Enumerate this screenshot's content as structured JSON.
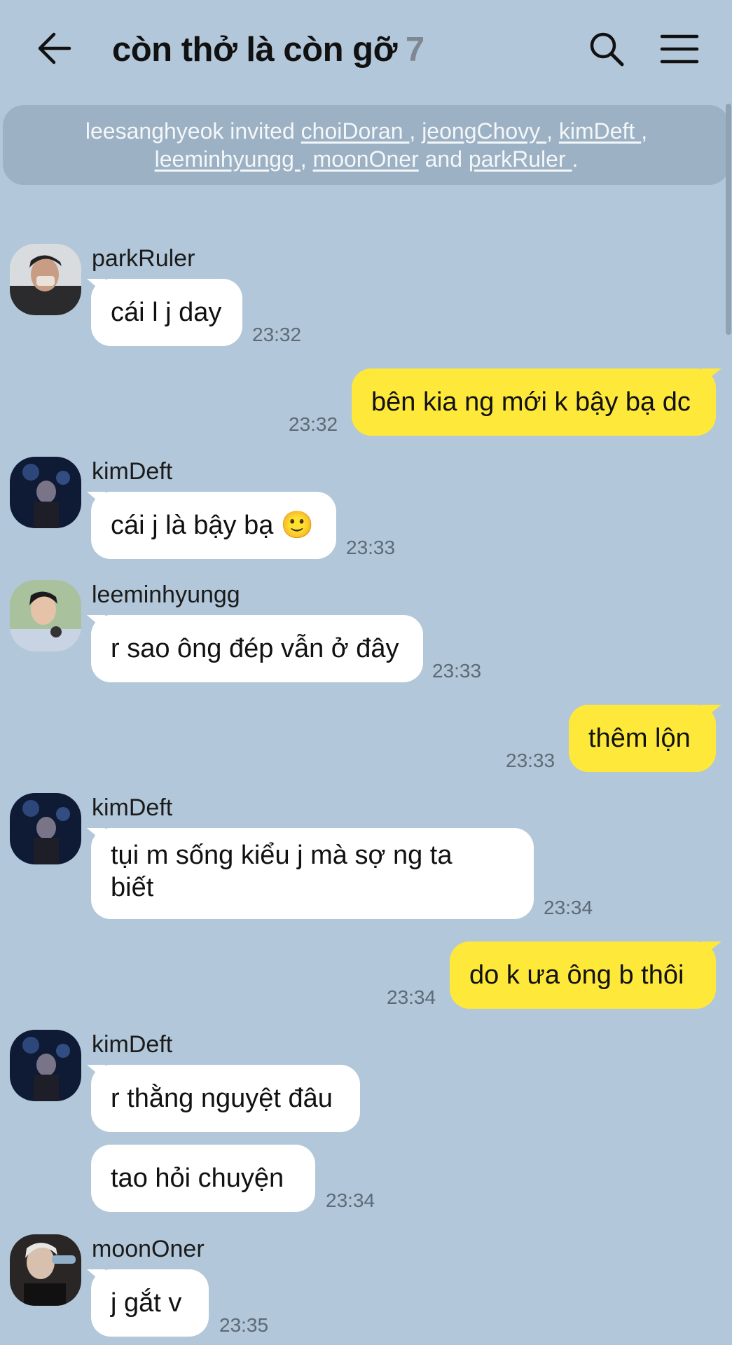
{
  "header": {
    "title": "còn thở là còn gỡ",
    "member_count": "7"
  },
  "notice": {
    "inviter": "leesanghyeok",
    "invited_word": "invited",
    "invitees": [
      "choiDoran ",
      "jeongChovy ",
      "kimDeft ",
      "leeminhyungg ",
      "moonOner",
      "parkRuler "
    ],
    "and_word": "and"
  },
  "messages": [
    {
      "sender": "parkRuler",
      "text": "cái l j day",
      "time": "23:32",
      "mine": false
    },
    {
      "text": "bên kia ng mới k bậy bạ dc",
      "time": "23:32",
      "mine": true
    },
    {
      "sender": "kimDeft",
      "text": "cái j là bậy bạ 🙂",
      "time": "23:33",
      "mine": false
    },
    {
      "sender": "leeminhyungg",
      "text": "r sao ông đép vẫn ở đây",
      "time": "23:33",
      "mine": false
    },
    {
      "text": "thêm lộn",
      "time": "23:33",
      "mine": true
    },
    {
      "sender": "kimDeft",
      "text_line1": "tụi m sống kiểu j mà sợ ng ta",
      "text_line2": "biết",
      "time": "23:34",
      "mine": false
    },
    {
      "text": "do k ưa ông b thôi",
      "time": "23:34",
      "mine": true
    },
    {
      "sender": "kimDeft",
      "text": "r thằng nguyệt đâu",
      "mine": false
    },
    {
      "text": "tao hỏi chuyện",
      "time": "23:34",
      "mine": false
    },
    {
      "sender": "moonOner",
      "text": "j gắt v",
      "time": "23:35",
      "mine": false
    }
  ],
  "icons": {
    "back": "arrow-left-icon",
    "search": "search-icon",
    "menu": "hamburger-menu-icon"
  },
  "colors": {
    "background": "#b2c7d9",
    "my_bubble": "#fee93b",
    "their_bubble": "#ffffff",
    "notice_bg": "#9cb1c3"
  }
}
